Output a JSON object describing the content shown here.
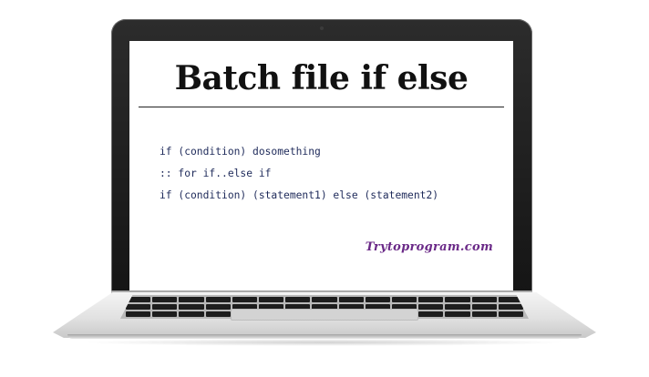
{
  "slide": {
    "title": "Batch file if else",
    "code_lines": [
      "if (condition) dosomething",
      ":: for if..else if",
      "if (condition) (statement1) else (statement2)"
    ],
    "brand": "Trytoprogram.com"
  },
  "colors": {
    "code_text": "#1e2a5a",
    "brand_text": "#6b2a88",
    "bezel": "#151515"
  }
}
